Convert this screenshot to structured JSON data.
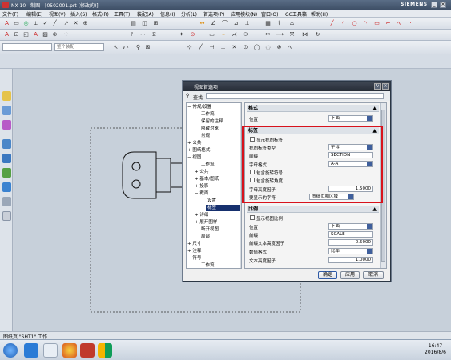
{
  "window": {
    "title": "NX 10 - 制图 - [0502001.prt (修改的)]",
    "brand": "SIEMENS"
  },
  "menu": [
    "文件(F)",
    "编辑(E)",
    "视图(V)",
    "插入(S)",
    "格式(R)",
    "工具(T)",
    "装配(A)",
    "信息(I)",
    "分析(L)",
    "首选项(P)",
    "应用模块(N)",
    "窗口(O)",
    "GC工具箱",
    "帮助(H)"
  ],
  "toolbar3_filter": "整个装配",
  "dialog": {
    "title": "视图首选项",
    "search_label": "查找",
    "tree": [
      {
        "label": "常规/设置",
        "level": 0,
        "expander": "−"
      },
      {
        "label": "工作流",
        "level": 1
      },
      {
        "label": "保留的注释",
        "level": 1
      },
      {
        "label": "隐藏对象",
        "level": 1
      },
      {
        "label": "常规",
        "level": 1
      },
      {
        "label": "公共",
        "level": 0,
        "expander": "+"
      },
      {
        "label": "图纸格式",
        "level": 0,
        "expander": "+"
      },
      {
        "label": "视图",
        "level": 0,
        "expander": "−"
      },
      {
        "label": "工作流",
        "level": 1
      },
      {
        "label": "公共",
        "level": 1,
        "expander": "+"
      },
      {
        "label": "基本/图纸",
        "level": 1,
        "expander": "+"
      },
      {
        "label": "投影",
        "level": 1,
        "expander": "+"
      },
      {
        "label": "截面",
        "level": 1,
        "expander": "−"
      },
      {
        "label": "设置",
        "level": 2
      },
      {
        "label": "标签",
        "level": 2,
        "selected": true
      },
      {
        "label": "详细",
        "level": 1,
        "expander": "+"
      },
      {
        "label": "展开图样",
        "level": 1,
        "expander": "+"
      },
      {
        "label": "断开视图",
        "level": 1
      },
      {
        "label": "局部",
        "level": 1
      },
      {
        "label": "尺寸",
        "level": 0,
        "expander": "+"
      },
      {
        "label": "注释",
        "level": 0,
        "expander": "+"
      },
      {
        "label": "符号",
        "level": 0,
        "expander": "−"
      },
      {
        "label": "工作流",
        "level": 1
      }
    ],
    "sections": {
      "format": {
        "header": "格式",
        "position_label": "位置",
        "position_value": "下面"
      },
      "label": {
        "header": "标签",
        "show_label": "显示视图标签",
        "label_type_label": "视图标签类型",
        "label_type_value": "字母",
        "prefix_label": "前缀",
        "prefix_value": "SECTION",
        "letter_format_label": "字母格式",
        "letter_format_value": "A-A",
        "include_rotation_symbol": "包含旋转符号",
        "include_rotation_angle": "包含旋转角度",
        "letter_height_label": "字母高度因子",
        "letter_height_value": "1.5000",
        "shown_on_sheet_label": "要显示的字符",
        "shown_on_sheet_value": "图纸页和区域"
      },
      "scale": {
        "header": "比例",
        "show_scale": "显示视图比例",
        "position_label": "位置",
        "position_value": "下面",
        "prefix_label": "前缀",
        "prefix_value": "SCALE",
        "prefix_height_label": "前缀文本高度因子",
        "prefix_height_value": "0.5000",
        "value_format_label": "数值格式",
        "value_format_value": "比率",
        "text_height_label": "文本高度因子",
        "text_height_value": "1.0000"
      }
    },
    "buttons": {
      "ok": "确定",
      "apply": "应用",
      "cancel": "取消"
    }
  },
  "status": "图纸页 \"SHT1\" 工作",
  "clock": {
    "time": "16:47",
    "date": "2016/8/6"
  },
  "colors": {
    "highlight": "#d8121c",
    "selection": "#16306e"
  }
}
